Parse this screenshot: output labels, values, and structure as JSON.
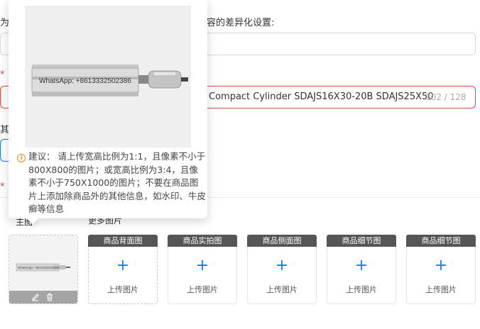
{
  "form": {
    "label_left_fragment": "为",
    "label_variant": "容的差异化设置:",
    "title_value": "Compact Cylinder SDAJS16X30-20B SDAJS25X50",
    "title_counter": "102 / 128",
    "label_other_fragment": "其",
    "required_mark": "*"
  },
  "images": {
    "more_images_label": "更多图片",
    "main_slot_label": "主图",
    "upload_label": "上传图片",
    "slots": [
      {
        "head": "商品背面图"
      },
      {
        "head": "商品实拍图"
      },
      {
        "head": "商品侧面图"
      },
      {
        "head": "商品细节图"
      },
      {
        "head": "商品细节图"
      }
    ]
  },
  "popover": {
    "watermark": "WhatsApp: +8613332502386",
    "tip_text": "建议： 请上传宽高比例为1:1，且像素不小于800X800的图片；或宽高比例为3:4，且像素不小于750X1000的图片；不要在商品图片上添加除商品外的其他信息，如水印、牛皮癣等信息"
  },
  "colors": {
    "accent": "#1677ff",
    "error": "#e0483e",
    "warning": "#e38b16"
  }
}
